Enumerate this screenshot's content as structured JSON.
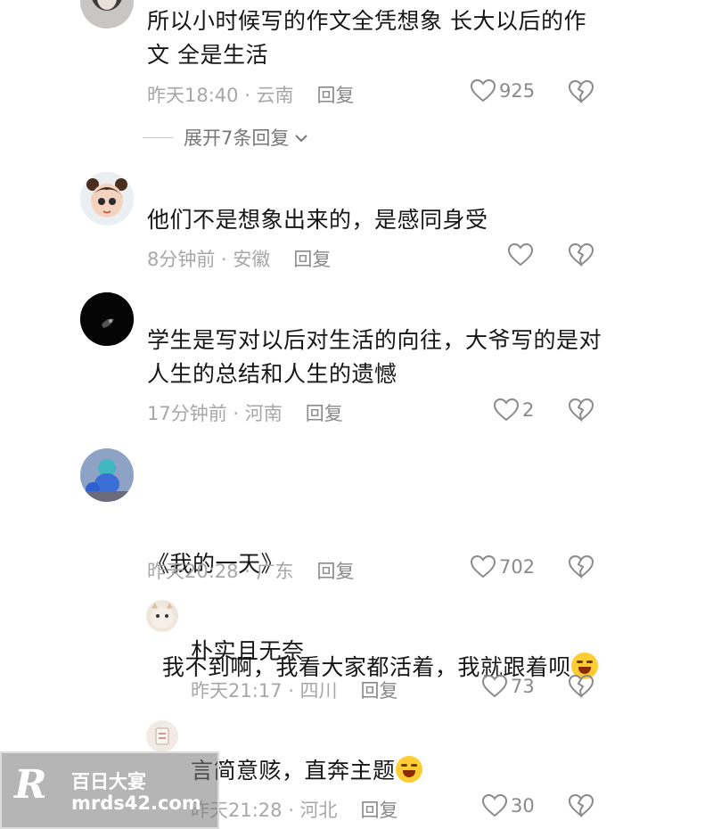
{
  "expand_replies": "展开7条回复",
  "comments": [
    {
      "text_line1": "所以小时候写的作文全凭想象 长大以后的作",
      "text_line2": "文 全是生活",
      "time": "昨天18:40 · 云南",
      "reply": "回复",
      "likes": "925"
    },
    {
      "text_line1": "他们不是想象出来的，是感同身受",
      "time": "8分钟前 · 安徽",
      "reply": "回复",
      "likes": ""
    },
    {
      "text_line1": "学生是写对以后对生活的向往，大爷写的是对",
      "text_line2": "人生的总结和人生的遗憾",
      "time": "17分钟前 · 河南",
      "reply": "回复",
      "likes": "2"
    },
    {
      "text_line1": "《我的一天》",
      "text_line2": "  我不到啊，我看大家都活着，我就跟着呗",
      "time": "昨天20:28 · 广东",
      "reply": "回复",
      "likes": "702"
    }
  ],
  "replies": [
    {
      "text": "朴实且无奈",
      "time": "昨天21:17 · 四川",
      "reply": "回复",
      "likes": "73"
    },
    {
      "text": "言简意赅，直奔主题",
      "time": "昨天21:28 · 河北",
      "reply": "回复",
      "likes": "30"
    }
  ],
  "watermark": {
    "logo": "R",
    "cn": "百日大宴",
    "url": "mrds42.com"
  },
  "colors": {
    "meta": "#a7a7a7",
    "text": "#161616",
    "emoji": "#ffcc33"
  }
}
